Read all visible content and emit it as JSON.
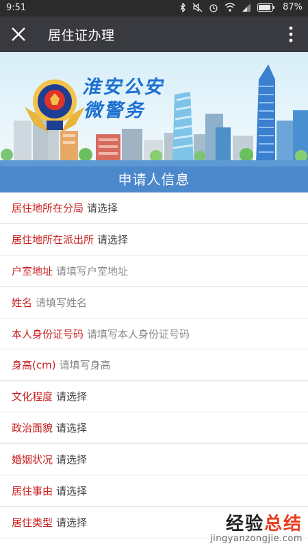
{
  "status_bar": {
    "time": "9:51",
    "battery": "87%"
  },
  "nav": {
    "title": "居住证办理"
  },
  "banner": {
    "line1": "淮安公安",
    "line2": "微警务"
  },
  "section": {
    "title": "申请人信息"
  },
  "form": {
    "rows": [
      {
        "label": "居住地所在分局",
        "value": "请选择"
      },
      {
        "label": "居住地所在派出所",
        "value": "请选择"
      },
      {
        "label": "户室地址",
        "value": "请填写户室地址"
      },
      {
        "label": "姓名",
        "value": "请填写姓名"
      },
      {
        "label": "本人身份证号码",
        "value": "请填写本人身份证号码"
      },
      {
        "label": "身高(cm)",
        "value": "请填写身高"
      },
      {
        "label": "文化程度",
        "value": "请选择"
      },
      {
        "label": "政治面貌",
        "value": "请选择"
      },
      {
        "label": "婚姻状况",
        "value": "请选择"
      },
      {
        "label": "居住事由",
        "value": "请选择"
      },
      {
        "label": "居住类型",
        "value": "请选择"
      }
    ]
  },
  "watermark": {
    "title_a": "经验",
    "title_b": "总结",
    "url": "jingyanzongjie.com"
  },
  "colors": {
    "nav": "#393a3f",
    "section": "#4c88cc",
    "label": "#c8201f",
    "banner_text": "#1a6fd0"
  }
}
